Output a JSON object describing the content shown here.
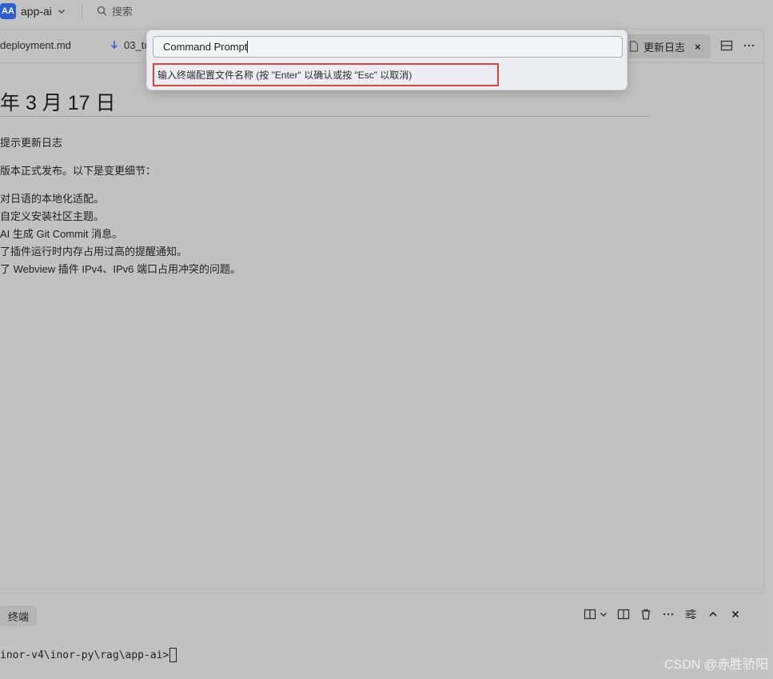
{
  "titlebar": {
    "badge": "AA",
    "project": "app-ai",
    "search_label": "搜索"
  },
  "tabs": [
    {
      "label": "deployment.md"
    },
    {
      "label": "03_tı"
    }
  ],
  "active_tab": {
    "label": "更新日志",
    "close": "×"
  },
  "document": {
    "title": "年 3 月 17 日",
    "lines": [
      "提示更新日志",
      "版本正式发布。以下是变更细节：",
      "对日语的本地化适配。",
      "自定义安装社区主题。",
      " AI 生成 Git Commit 消息。",
      "了插件运行时内存占用过高的提醒通知。",
      "了 Webview 插件 IPv4、IPv6 端口占用冲突的问题。"
    ]
  },
  "palette": {
    "input_value": "Command Prompt",
    "hint": "输入终端配置文件名称 (按 \"Enter\" 以确认或按 \"Esc\" 以取消)"
  },
  "terminal": {
    "tab_label": "终端",
    "prompt": "inor-v4\\inor-py\\rag\\app-ai>"
  },
  "watermark": "CSDN @赤胜骄阳",
  "colors": {
    "badge": "#2f5fce",
    "highlight_border": "#e0443e",
    "overlay_bg": "#c2c2c2"
  }
}
